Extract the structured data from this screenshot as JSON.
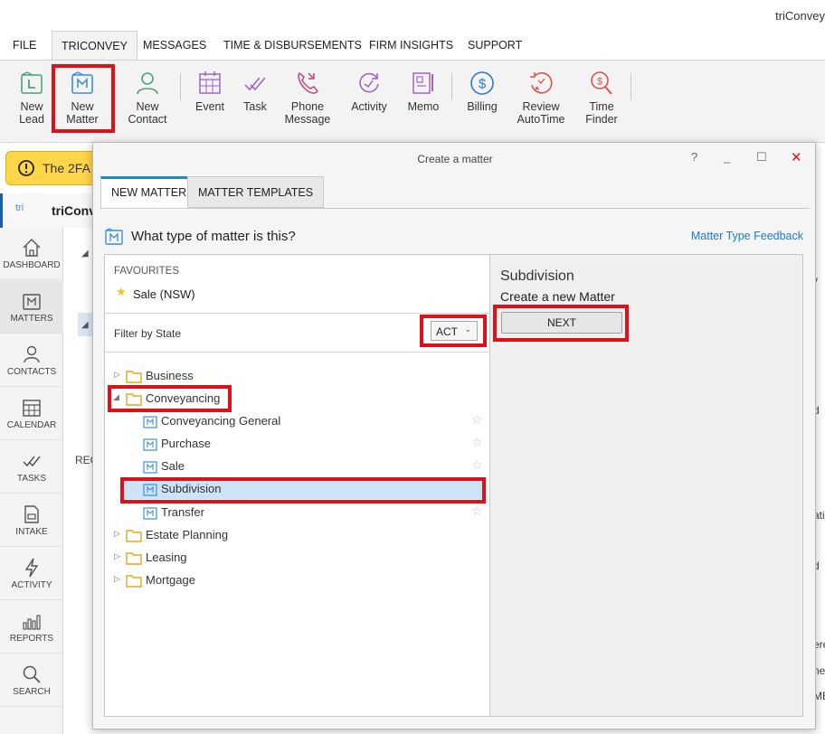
{
  "app": {
    "title": "triConvey"
  },
  "menu": {
    "items": [
      "FILE",
      "TRICONVEY",
      "MESSAGES",
      "TIME & DISBURSEMENTS",
      "FIRM INSIGHTS",
      "SUPPORT"
    ]
  },
  "ribbon": {
    "buttons": [
      {
        "line1": "New",
        "line2": "Lead",
        "icon": "new-lead-icon"
      },
      {
        "line1": "New",
        "line2": "Matter",
        "icon": "new-matter-icon"
      },
      {
        "line1": "New",
        "line2": "Contact",
        "icon": "new-contact-icon"
      },
      {
        "line1": "Event",
        "line2": "",
        "icon": "calendar-icon"
      },
      {
        "line1": "Task",
        "line2": "",
        "icon": "task-icon"
      },
      {
        "line1": "Phone",
        "line2": "Message",
        "icon": "phone-message-icon"
      },
      {
        "line1": "Activity",
        "line2": "",
        "icon": "activity-icon"
      },
      {
        "line1": "Memo",
        "line2": "",
        "icon": "memo-icon"
      },
      {
        "line1": "Billing",
        "line2": "",
        "icon": "billing-icon"
      },
      {
        "line1": "Review",
        "line2": "AutoTime",
        "icon": "review-autotime-icon"
      },
      {
        "line1": "Time",
        "line2": "Finder",
        "icon": "time-finder-icon"
      }
    ]
  },
  "background": {
    "banner_text": "The 2FA",
    "app_tab_logo": "tri",
    "app_tab_label": "triConv",
    "recent_label": "REC",
    "fragments": [
      "y",
      "d",
      "ati",
      "d",
      "ere",
      "ne",
      "ME"
    ]
  },
  "leftnav": {
    "items": [
      {
        "label": "DASHBOARD",
        "icon": "home-icon"
      },
      {
        "label": "MATTERS",
        "icon": "matters-icon"
      },
      {
        "label": "CONTACTS",
        "icon": "contacts-icon"
      },
      {
        "label": "CALENDAR",
        "icon": "calendar-icon"
      },
      {
        "label": "TASKS",
        "icon": "tasks-icon"
      },
      {
        "label": "INTAKE",
        "icon": "intake-icon"
      },
      {
        "label": "ACTIVITY",
        "icon": "activity-bolt-icon"
      },
      {
        "label": "REPORTS",
        "icon": "reports-icon"
      },
      {
        "label": "SEARCH",
        "icon": "search-icon"
      }
    ]
  },
  "dialog": {
    "title": "Create a matter",
    "help": "?",
    "minimize": "_",
    "maximize": "☐",
    "close": "✕",
    "tabs": [
      "NEW MATTER",
      "MATTER TEMPLATES"
    ],
    "question": "What type of matter is this?",
    "feedback_link": "Matter Type Feedback",
    "favourites_label": "FAVOURITES",
    "favourites": [
      "Sale (NSW)"
    ],
    "filter_label": "Filter by State",
    "state_value": "ACT",
    "tree": {
      "business": "Business",
      "conveyancing": "Conveyancing",
      "conveyancing_children": [
        "Conveyancing General",
        "Purchase",
        "Sale",
        "Subdivision",
        "Transfer"
      ],
      "estate_planning": "Estate Planning",
      "leasing": "Leasing",
      "mortgage": "Mortgage"
    },
    "selected": {
      "title": "Subdivision",
      "description": "Create a new Matter",
      "next_label": "NEXT"
    }
  },
  "colors": {
    "highlight": "#e0101a",
    "accent": "#1b8ad6",
    "selection": "#cde3f7",
    "folder": "#f0a21b",
    "matter_icon": "#3d8fd0"
  }
}
